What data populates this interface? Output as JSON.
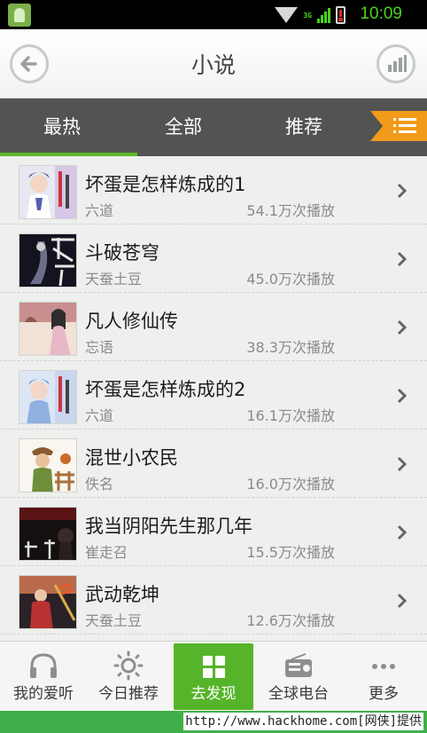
{
  "status_bar": {
    "time": "10:09",
    "network_label": "3G",
    "app_icon": "phone-app-icon",
    "colors": {
      "accent": "#4bd321",
      "battery": "#d62d2d"
    }
  },
  "header": {
    "title": "小说",
    "back_icon": "back-arrow-icon",
    "stats_icon": "bar-chart-icon"
  },
  "tabs": {
    "items": [
      {
        "label": "最热",
        "active": true
      },
      {
        "label": "全部",
        "active": false
      },
      {
        "label": "推荐",
        "active": false
      }
    ],
    "menu_icon": "list-menu-icon",
    "colors": {
      "background": "#535352",
      "indicator": "#5dbb2a",
      "menu_flag": "#f29a1a"
    }
  },
  "list": {
    "items": [
      {
        "title": "坏蛋是怎样炼成的1",
        "author": "六道",
        "plays": "54.1万次播放",
        "cover": "cover-huaidan-1"
      },
      {
        "title": "斗破苍穹",
        "author": "天蚕土豆",
        "plays": "45.0万次播放",
        "cover": "cover-doupo"
      },
      {
        "title": "凡人修仙传",
        "author": "忘语",
        "plays": "38.3万次播放",
        "cover": "cover-fanren"
      },
      {
        "title": "坏蛋是怎样炼成的2",
        "author": "六道",
        "plays": "16.1万次播放",
        "cover": "cover-huaidan-2"
      },
      {
        "title": "混世小农民",
        "author": "佚名",
        "plays": "16.0万次播放",
        "cover": "cover-hunshi"
      },
      {
        "title": "我当阴阳先生那几年",
        "author": "崔走召",
        "plays": "15.5万次播放",
        "cover": "cover-yinyang"
      },
      {
        "title": "武动乾坤",
        "author": "天蚕土豆",
        "plays": "12.6万次播放",
        "cover": "cover-wudong"
      }
    ]
  },
  "bottom_nav": {
    "items": [
      {
        "label": "我的爱听",
        "icon": "headphones-icon",
        "active": false
      },
      {
        "label": "今日推荐",
        "icon": "sun-icon",
        "active": false
      },
      {
        "label": "去发现",
        "icon": "grid-icon",
        "active": true
      },
      {
        "label": "全球电台",
        "icon": "radio-icon",
        "active": false
      },
      {
        "label": "更多",
        "icon": "more-dots-icon",
        "active": false
      }
    ],
    "colors": {
      "active": "#56b42a"
    }
  },
  "footer": {
    "text": "http://www.hackhome.com[网侠]提供"
  }
}
